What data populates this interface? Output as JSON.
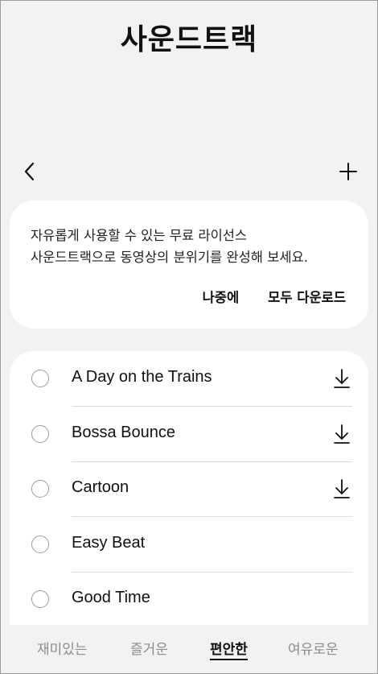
{
  "header": {
    "title": "사운드트랙"
  },
  "nav": {
    "back_icon": "chevron-left-icon",
    "add_icon": "plus-icon"
  },
  "banner": {
    "line1": "자유롭게 사용할 수 있는 무료 라이선스",
    "line2": "사운드트랙으로 동영상의 분위기를 완성해 보세요.",
    "later_label": "나중에",
    "download_all_label": "모두 다운로드"
  },
  "tracks": [
    {
      "title": "A Day on the Trains",
      "downloadable": true
    },
    {
      "title": "Bossa Bounce",
      "downloadable": true
    },
    {
      "title": "Cartoon",
      "downloadable": true
    },
    {
      "title": "Easy Beat",
      "downloadable": false
    },
    {
      "title": "Good Time",
      "downloadable": false
    }
  ],
  "tabs": [
    {
      "label": "재미있는",
      "active": false
    },
    {
      "label": "즐거운",
      "active": false
    },
    {
      "label": "편안한",
      "active": true
    },
    {
      "label": "여유로운",
      "active": false
    }
  ]
}
